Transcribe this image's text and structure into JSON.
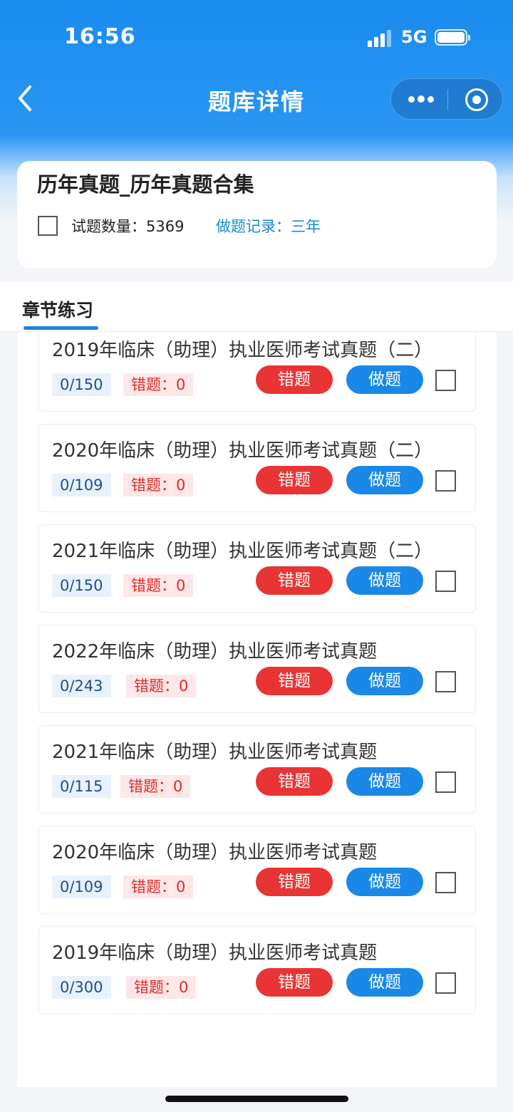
{
  "status": {
    "time": "16:56",
    "network": "5G"
  },
  "header": {
    "title": "题库详情"
  },
  "info": {
    "title": "历年真题_历年真题合集",
    "count_label": "试题数量：5369",
    "record_label": "做题记录：三年"
  },
  "tabs": [
    {
      "label": "章节练习",
      "active": true
    }
  ],
  "buttons": {
    "wrong_label": "错题",
    "do_label": "做题"
  },
  "items": [
    {
      "title": "2019年临床（助理）执业医师考试真题（二）",
      "progress": "0/150",
      "wrong": "错题：0"
    },
    {
      "title": "2020年临床（助理）执业医师考试真题（二）",
      "progress": "0/109",
      "wrong": "错题：0"
    },
    {
      "title": "2021年临床（助理）执业医师考试真题（二）",
      "progress": "0/150",
      "wrong": "错题：0"
    },
    {
      "title": "2022年临床（助理）执业医师考试真题",
      "progress": "0/243",
      "wrong": "错题：0"
    },
    {
      "title": "2021年临床（助理）执业医师考试真题",
      "progress": "0/115",
      "wrong": "错题：0"
    },
    {
      "title": "2020年临床（助理）执业医师考试真题",
      "progress": "0/109",
      "wrong": "错题：0"
    },
    {
      "title": "2019年临床（助理）执业医师考试真题",
      "progress": "0/300",
      "wrong": "错题：0"
    }
  ],
  "colors": {
    "primary": "#1a88e6",
    "danger": "#e83434"
  }
}
